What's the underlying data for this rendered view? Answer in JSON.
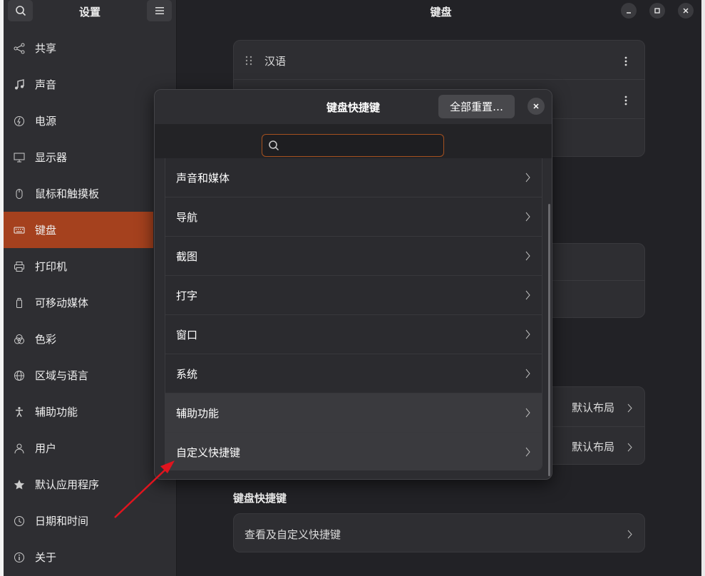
{
  "sidebar": {
    "title": "设置",
    "items": [
      {
        "label": "共享",
        "icon": "share-icon"
      },
      {
        "label": "声音",
        "icon": "music-note-icon"
      },
      {
        "label": "电源",
        "icon": "power-icon"
      },
      {
        "label": "显示器",
        "icon": "display-icon"
      },
      {
        "label": "鼠标和触摸板",
        "icon": "mouse-icon"
      },
      {
        "label": "键盘",
        "icon": "keyboard-icon",
        "active": true
      },
      {
        "label": "打印机",
        "icon": "printer-icon"
      },
      {
        "label": "可移动媒体",
        "icon": "removable-media-icon"
      },
      {
        "label": "色彩",
        "icon": "color-icon"
      },
      {
        "label": "区域与语言",
        "icon": "globe-icon"
      },
      {
        "label": "辅助功能",
        "icon": "accessibility-icon"
      },
      {
        "label": "用户",
        "icon": "user-icon"
      },
      {
        "label": "默认应用程序",
        "icon": "star-icon"
      },
      {
        "label": "日期和时间",
        "icon": "clock-icon"
      },
      {
        "label": "关于",
        "icon": "info-icon"
      }
    ]
  },
  "main": {
    "title": "键盘",
    "input_source": "汉语",
    "layout_value_1": "默认布局",
    "layout_value_2": "默认布局",
    "shortcuts_section_title": "键盘快捷键",
    "shortcuts_row": "查看及自定义快捷键"
  },
  "dialog": {
    "title": "键盘快捷键",
    "reset_label": "全部重置…",
    "search_placeholder": "",
    "categories": [
      "声音和媒体",
      "导航",
      "截图",
      "打字",
      "窗口",
      "系统",
      "辅助功能",
      "自定义快捷键"
    ]
  },
  "colors": {
    "accent": "#a5411e",
    "annotation_arrow": "#e0141e"
  }
}
